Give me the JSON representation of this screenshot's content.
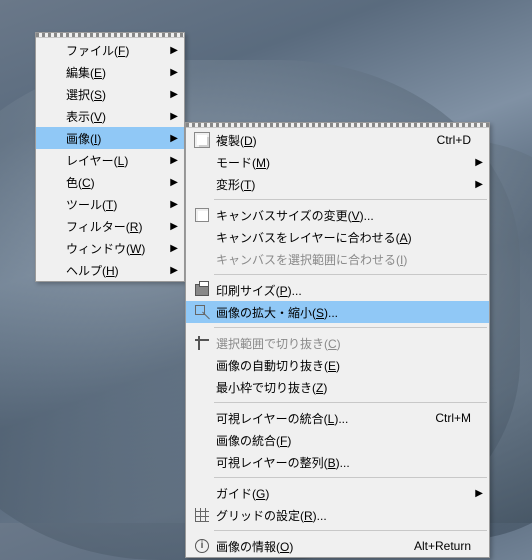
{
  "primary_menu": {
    "items": [
      {
        "label": "ファイル",
        "mn": "F",
        "submenu": true
      },
      {
        "label": "編集",
        "mn": "E",
        "submenu": true
      },
      {
        "label": "選択",
        "mn": "S",
        "submenu": true
      },
      {
        "label": "表示",
        "mn": "V",
        "submenu": true
      },
      {
        "label": "画像",
        "mn": "I",
        "submenu": true,
        "highlight": true
      },
      {
        "label": "レイヤー",
        "mn": "L",
        "submenu": true
      },
      {
        "label": "色",
        "mn": "C",
        "submenu": true
      },
      {
        "label": "ツール",
        "mn": "T",
        "submenu": true
      },
      {
        "label": "フィルター",
        "mn": "R",
        "submenu": true
      },
      {
        "label": "ウィンドウ",
        "mn": "W",
        "submenu": true
      },
      {
        "label": "ヘルプ",
        "mn": "H",
        "submenu": true
      }
    ]
  },
  "image_submenu": {
    "items": [
      {
        "label": "複製",
        "mn": "D",
        "shortcut": "Ctrl+D",
        "icon": "dup"
      },
      {
        "label": "モード",
        "mn": "M",
        "submenu": true
      },
      {
        "label": "変形",
        "mn": "T",
        "submenu": true
      },
      {
        "sep": true
      },
      {
        "label": "キャンバスサイズの変更",
        "mn": "V",
        "ellipsis": true,
        "icon": "canvas"
      },
      {
        "label": "キャンバスをレイヤーに合わせる",
        "mn": "A"
      },
      {
        "label": "キャンバスを選択範囲に合わせる",
        "mn": "I",
        "disabled": true
      },
      {
        "sep": true
      },
      {
        "label": "印刷サイズ",
        "mn": "P",
        "ellipsis": true,
        "icon": "print"
      },
      {
        "label": "画像の拡大・縮小",
        "mn": "S",
        "ellipsis": true,
        "icon": "scale",
        "highlight": true
      },
      {
        "sep": true
      },
      {
        "label": "選択範囲で切り抜き",
        "mn": "C",
        "disabled": true,
        "icon": "crop"
      },
      {
        "label": "画像の自動切り抜き",
        "mn": "E"
      },
      {
        "label": "最小枠で切り抜き",
        "mn": "Z"
      },
      {
        "sep": true
      },
      {
        "label": "可視レイヤーの統合",
        "mn": "L",
        "shortcut": "Ctrl+M",
        "ellipsis": true
      },
      {
        "label": "画像の統合",
        "mn": "F"
      },
      {
        "label": "可視レイヤーの整列",
        "mn": "B",
        "ellipsis": true
      },
      {
        "sep": true
      },
      {
        "label": "ガイド",
        "mn": "G",
        "submenu": true
      },
      {
        "label": "グリッドの設定",
        "mn": "R",
        "ellipsis": true,
        "icon": "grid"
      },
      {
        "sep": true
      },
      {
        "label": "画像の情報",
        "mn": "O",
        "shortcut": "Alt+Return",
        "icon": "info"
      }
    ]
  }
}
